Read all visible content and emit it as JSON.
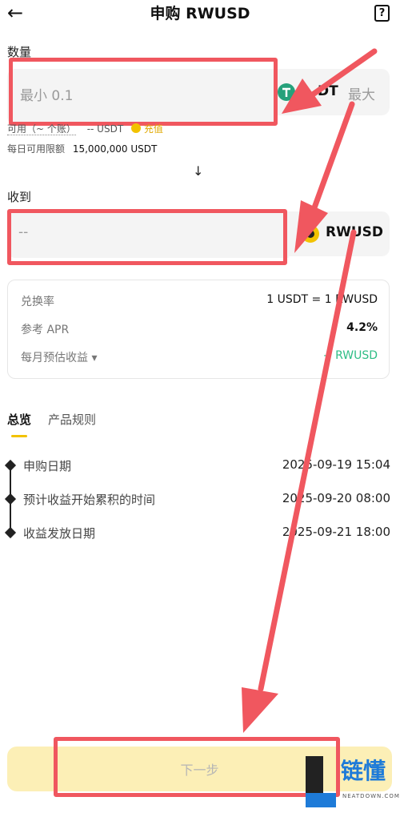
{
  "header": {
    "title": "申购 RWUSD",
    "back_icon": "←",
    "help_icon": "?"
  },
  "amount": {
    "label": "数量",
    "placeholder": "最小 0.1",
    "token": "DT",
    "max_label": "最大",
    "available_text": "可用（~ 个账）",
    "available_value": "-- USDT",
    "recharge_label": "充值",
    "daily_limit_label": "每日可用限额",
    "daily_limit_value": "15,000,000 USDT"
  },
  "swap_arrow": "↓",
  "receive": {
    "label": "收到",
    "placeholder": "--",
    "token": "RWUSD"
  },
  "info": {
    "rows": [
      {
        "key": "兑换率",
        "value": "1 USDT = 1 RWUSD"
      },
      {
        "key": "参考 APR",
        "value": "4.2%"
      },
      {
        "key": "每月预估收益 ▾",
        "value": "-- RWUSD"
      }
    ]
  },
  "tabs": [
    "总览",
    "产品规则"
  ],
  "timeline": [
    {
      "label": "申购日期",
      "time": "2025-09-19 15:04"
    },
    {
      "label": "预计收益开始累积的时间",
      "time": "2025-09-20 08:00"
    },
    {
      "label": "收益发放日期",
      "time": "2025-09-21 18:00"
    }
  ],
  "next_button": "下一步",
  "watermark": {
    "brand": "链懂",
    "site": "NEATDOWN.COM"
  },
  "colors": {
    "annotation_red": "#f0575f",
    "accent_yellow": "#f2c200",
    "usdt_green": "#26a17b",
    "positive_green": "#2ebd85",
    "button_bg": "#fcefb6"
  }
}
